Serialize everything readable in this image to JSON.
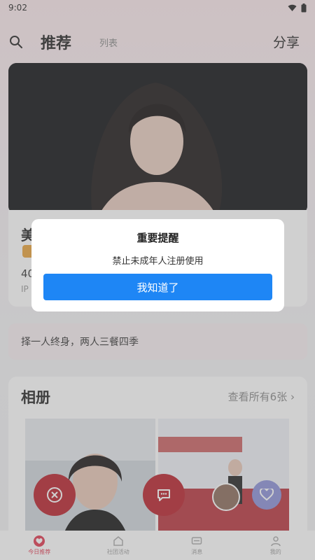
{
  "status": {
    "time": "9:02"
  },
  "header": {
    "title": "推荐",
    "tab_list": "列表",
    "share": "分享"
  },
  "profile": {
    "name_partial": "美",
    "age_partial": "40",
    "ip_partial": "IP"
  },
  "quote": "择一人终身，两人三餐四季",
  "album": {
    "title": "相册",
    "more": "查看所有6张"
  },
  "dialog": {
    "title": "重要提醒",
    "message": "禁止未成年人注册使用",
    "button": "我知道了"
  },
  "nav": [
    {
      "label": "今日推荐",
      "icon": "heart-icon",
      "active": true
    },
    {
      "label": "社团活动",
      "icon": "home-icon",
      "active": false
    },
    {
      "label": "消息",
      "icon": "message-icon",
      "active": false
    },
    {
      "label": "我的",
      "icon": "user-icon",
      "active": false
    }
  ],
  "colors": {
    "accent_red": "#b8202a",
    "primary_blue": "#1e86f5",
    "nav_active": "#e0364e"
  }
}
